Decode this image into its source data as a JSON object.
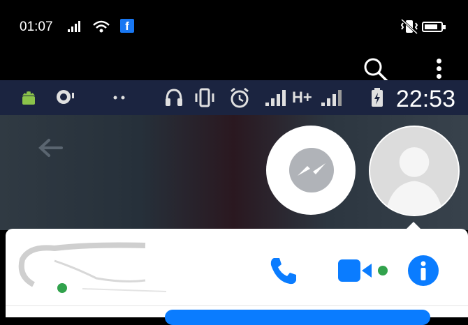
{
  "outer_status_bar": {
    "time": "01:07",
    "signal_icon": "signal-bars-icon",
    "wifi_icon": "wifi-icon",
    "notification_app": "f",
    "mute_icon": "vibrate-mute-icon",
    "battery_icon": "battery-icon"
  },
  "app_bar": {
    "search_icon": "search-icon",
    "menu_icon": "more-vertical-icon"
  },
  "inner_status_bar": {
    "time": "22:53",
    "icons": [
      "android-icon",
      "chat-icon",
      "headset-icon",
      "vibrate-icon",
      "alarm-icon",
      "signal-icon",
      "H+",
      "signal-icon",
      "battery-charging-icon"
    ],
    "network_label": "H+"
  },
  "chat_heads": {
    "messenger_icon": "messenger-icon",
    "avatar_icon": "default-avatar-icon"
  },
  "contact_panel": {
    "online_status": "online",
    "actions": [
      "voice-call",
      "video-call",
      "info"
    ]
  },
  "colors": {
    "accent": "#0a7cff",
    "online": "#31a24c",
    "status_dark": "#1b2440"
  }
}
